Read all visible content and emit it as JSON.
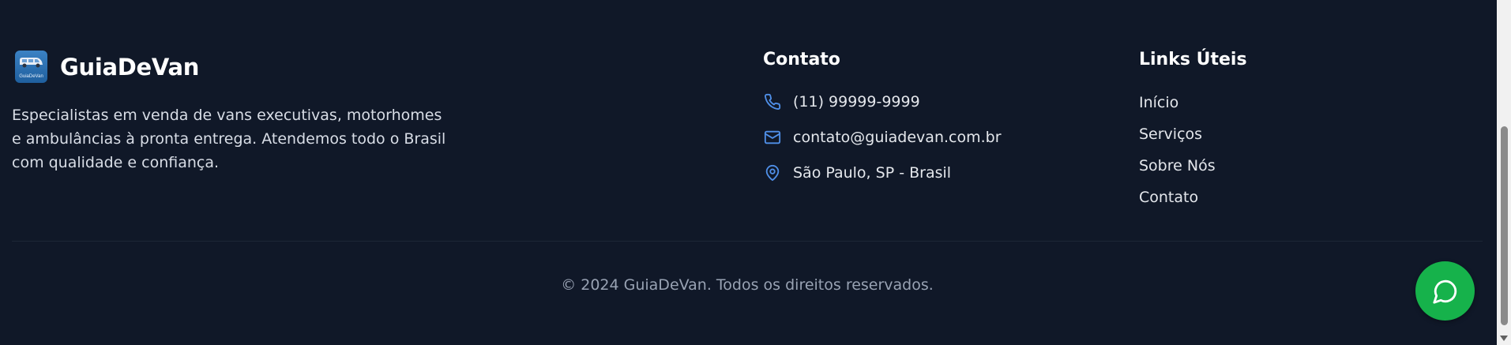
{
  "brand": {
    "name": "GuiaDeVan",
    "logo_text": "GuiaDeVan",
    "description": "Especialistas em venda de vans executivas, motorhomes e ambulâncias à pronta entrega. Atendemos todo o Brasil com qualidade e confiança."
  },
  "contact": {
    "title": "Contato",
    "phone": "(11) 99999-9999",
    "email": "contato@guiadevan.com.br",
    "location": "São Paulo, SP - Brasil"
  },
  "links": {
    "title": "Links Úteis",
    "items": [
      "Início",
      "Serviços",
      "Sobre Nós",
      "Contato"
    ]
  },
  "copyright": "© 2024 GuiaDeVan. Todos os direitos reservados.",
  "colors": {
    "background": "#101828",
    "icon_accent": "#4f8fe8",
    "whatsapp": "#16b24b"
  },
  "icons": {
    "phone": "phone-icon",
    "email": "mail-icon",
    "location": "map-pin-icon",
    "whatsapp": "chat-bubble-icon"
  }
}
